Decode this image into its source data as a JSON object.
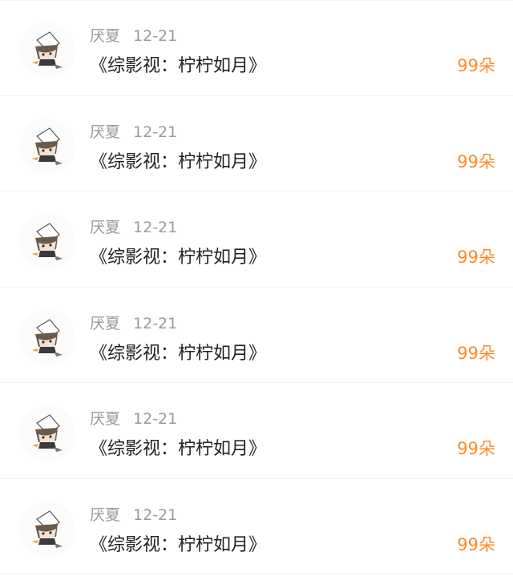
{
  "colors": {
    "background": "#ffffff",
    "username": "#9a9a9a",
    "title": "#222222",
    "gift": "#ff8a2a",
    "divider": "#f3f3f3"
  },
  "items": [
    {
      "username": "厌夏",
      "date": "12-21",
      "title": "《综影视：柠柠如月》",
      "gift": "99朵",
      "avatar_icon": "anime-character-avatar-icon"
    },
    {
      "username": "厌夏",
      "date": "12-21",
      "title": "《综影视：柠柠如月》",
      "gift": "99朵",
      "avatar_icon": "anime-character-avatar-icon"
    },
    {
      "username": "厌夏",
      "date": "12-21",
      "title": "《综影视：柠柠如月》",
      "gift": "99朵",
      "avatar_icon": "anime-character-avatar-icon"
    },
    {
      "username": "厌夏",
      "date": "12-21",
      "title": "《综影视：柠柠如月》",
      "gift": "99朵",
      "avatar_icon": "anime-character-avatar-icon"
    },
    {
      "username": "厌夏",
      "date": "12-21",
      "title": "《综影视：柠柠如月》",
      "gift": "99朵",
      "avatar_icon": "anime-character-avatar-icon"
    },
    {
      "username": "厌夏",
      "date": "12-21",
      "title": "《综影视：柠柠如月》",
      "gift": "99朵",
      "avatar_icon": "anime-character-avatar-icon"
    }
  ]
}
